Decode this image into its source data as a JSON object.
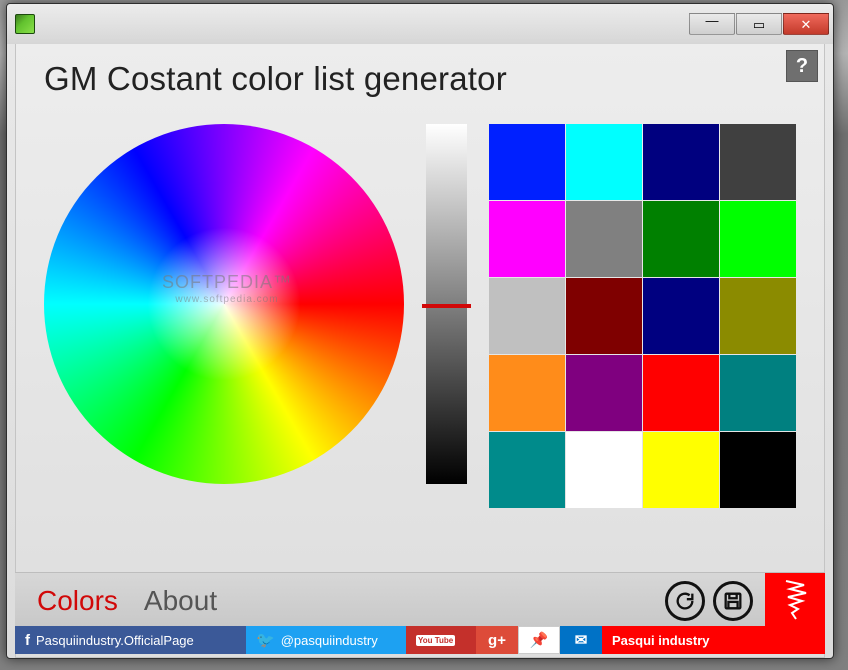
{
  "backdrop_watermark": "SOFTPEDIA",
  "watermark": {
    "main": "SOFTPEDIA™",
    "sub": "www.softpedia.com"
  },
  "title": "GM Costant color list generator",
  "help_label": "?",
  "tabs": {
    "colors": "Colors",
    "about": "About"
  },
  "swatches": [
    "#0020ff",
    "#00ffff",
    "#00007f",
    "#404040",
    "#ff00ff",
    "#808080",
    "#008000",
    "#00ff00",
    "#c0c0c0",
    "#7f0000",
    "#000080",
    "#8b8b00",
    "#ff8c1a",
    "#7f007f",
    "#ff0000",
    "#008080",
    "#008b8b",
    "#ffffff",
    "#ffff00",
    "#000000"
  ],
  "social": {
    "fb_label": "Pasquiindustry.OfficialPage",
    "tw_label": "@pasquiindustry",
    "yt_label": "You Tube",
    "gp_label": "g+",
    "pin_glyph": "📌",
    "mail_glyph": "✉",
    "site_label": "Pasqui industry"
  },
  "win": {
    "min": "—",
    "max": "▭",
    "close": "✕"
  }
}
